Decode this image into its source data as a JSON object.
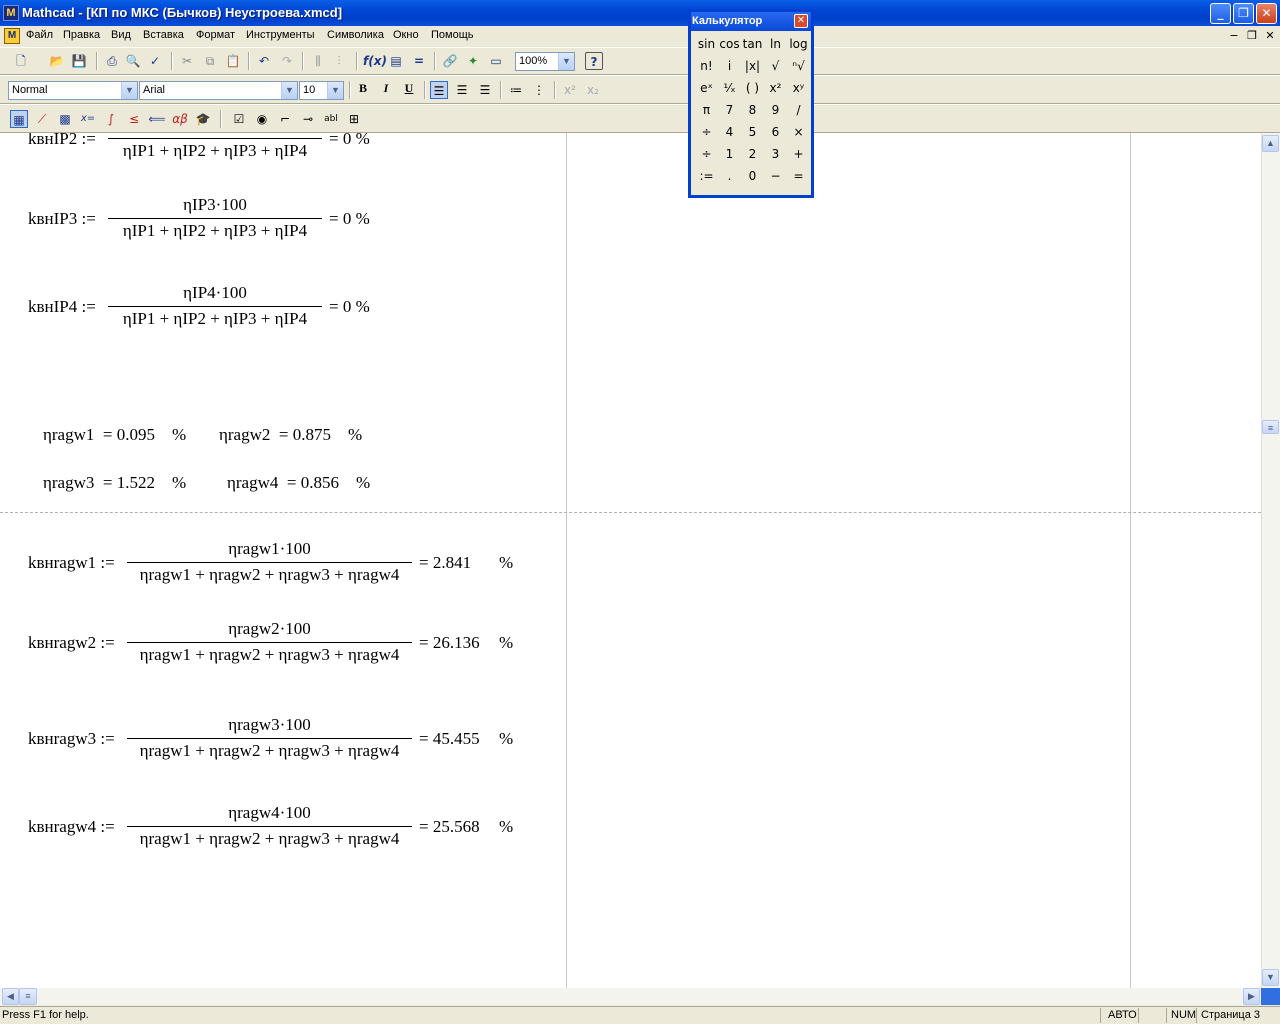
{
  "window": {
    "title": "Mathcad - [КП по МКС (Бычков) Неустроева.xmcd]",
    "app_icon": "mathcad-logo-icon"
  },
  "menu": [
    "Файл",
    "Правка",
    "Вид",
    "Вставка",
    "Формат",
    "Инструменты",
    "Символика",
    "Окно",
    "Помощь"
  ],
  "toolbar_standard": {
    "zoom_value": "100%"
  },
  "toolbar_format": {
    "style_value": "Normal",
    "font_value": "Arial",
    "size_value": "10",
    "bold": "B",
    "italic": "I",
    "underline": "U"
  },
  "calculator": {
    "title": "Калькулятор",
    "buttons": [
      [
        "sin",
        "cos",
        "tan",
        "ln",
        "log"
      ],
      [
        "n!",
        "i",
        "|x|",
        "√",
        "ⁿ√"
      ],
      [
        "eˣ",
        "¹⁄ₓ",
        "( )",
        "x²",
        "xʸ"
      ],
      [
        "π",
        "7",
        "8",
        "9",
        "/"
      ],
      [
        "÷",
        "4",
        "5",
        "6",
        "×"
      ],
      [
        "÷",
        "1",
        "2",
        "3",
        "+"
      ],
      [
        ":=",
        ".",
        "0",
        "−",
        "="
      ]
    ]
  },
  "worksheet": {
    "k2": {
      "lhs": "kвнIP2 :=",
      "den": "ηIP1 + ηIP2 + ηIP3 + ηIP4",
      "res": "= 0  %"
    },
    "k3": {
      "lhs": "kвнIP3 :=",
      "num": "ηIP3·100",
      "den": "ηIP1 + ηIP2 + ηIP3 + ηIP4",
      "res": "= 0  %"
    },
    "k4": {
      "lhs": "kвнIP4 :=",
      "num": "ηIP4·100",
      "den": "ηIP1 + ηIP2 + ηIP3 + ηIP4",
      "res": "= 0  %"
    },
    "eta_line1": {
      "a": "ηragw1  = 0.095    %",
      "b": "ηragw2  = 0.875    %"
    },
    "eta_line2": {
      "a": "ηragw3  = 1.522    %",
      "b": "ηragw4  = 0.856    %"
    },
    "den_ragw": "ηragw1 + ηragw2 + ηragw3 + ηragw4",
    "r1": {
      "lhs": "kвнragw1 :=",
      "num": "ηragw1·100",
      "res": "= 2.841",
      "unit": "%"
    },
    "r2": {
      "lhs": "kвнragw2 :=",
      "num": "ηragw2·100",
      "res": "= 26.136",
      "unit": "%"
    },
    "r3": {
      "lhs": "kвнragw3 :=",
      "num": "ηragw3·100",
      "res": "= 45.455",
      "unit": "%"
    },
    "r4": {
      "lhs": "kвнragw4 :=",
      "num": "ηragw4·100",
      "res": "= 25.568",
      "unit": "%"
    }
  },
  "status": {
    "help": "Press F1 for help.",
    "mode": "АВТО",
    "num": "NUM",
    "page": "Страница 3"
  }
}
